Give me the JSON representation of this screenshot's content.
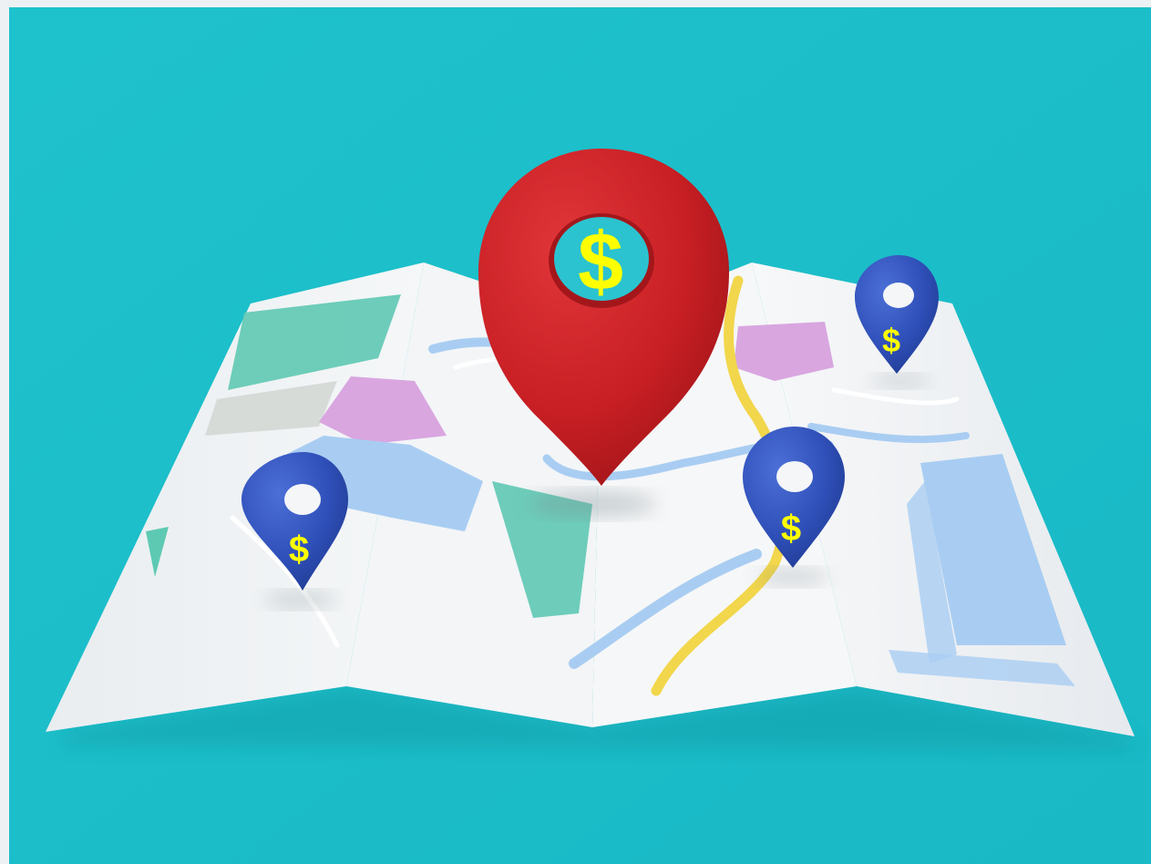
{
  "illustration": {
    "background_color": "#1dbfca",
    "map_paper_color": "#f2f4f6",
    "accent_red": "#c81f24",
    "accent_blue": "#2f4fb8",
    "symbol_yellow": "#ffff00",
    "main_pin": {
      "symbol": "$",
      "icon": "map-pin-icon"
    },
    "small_pins": [
      {
        "symbol": "$",
        "icon": "map-pin-icon"
      },
      {
        "symbol": "$",
        "icon": "map-pin-icon"
      },
      {
        "symbol": "$",
        "icon": "map-pin-icon"
      }
    ]
  }
}
